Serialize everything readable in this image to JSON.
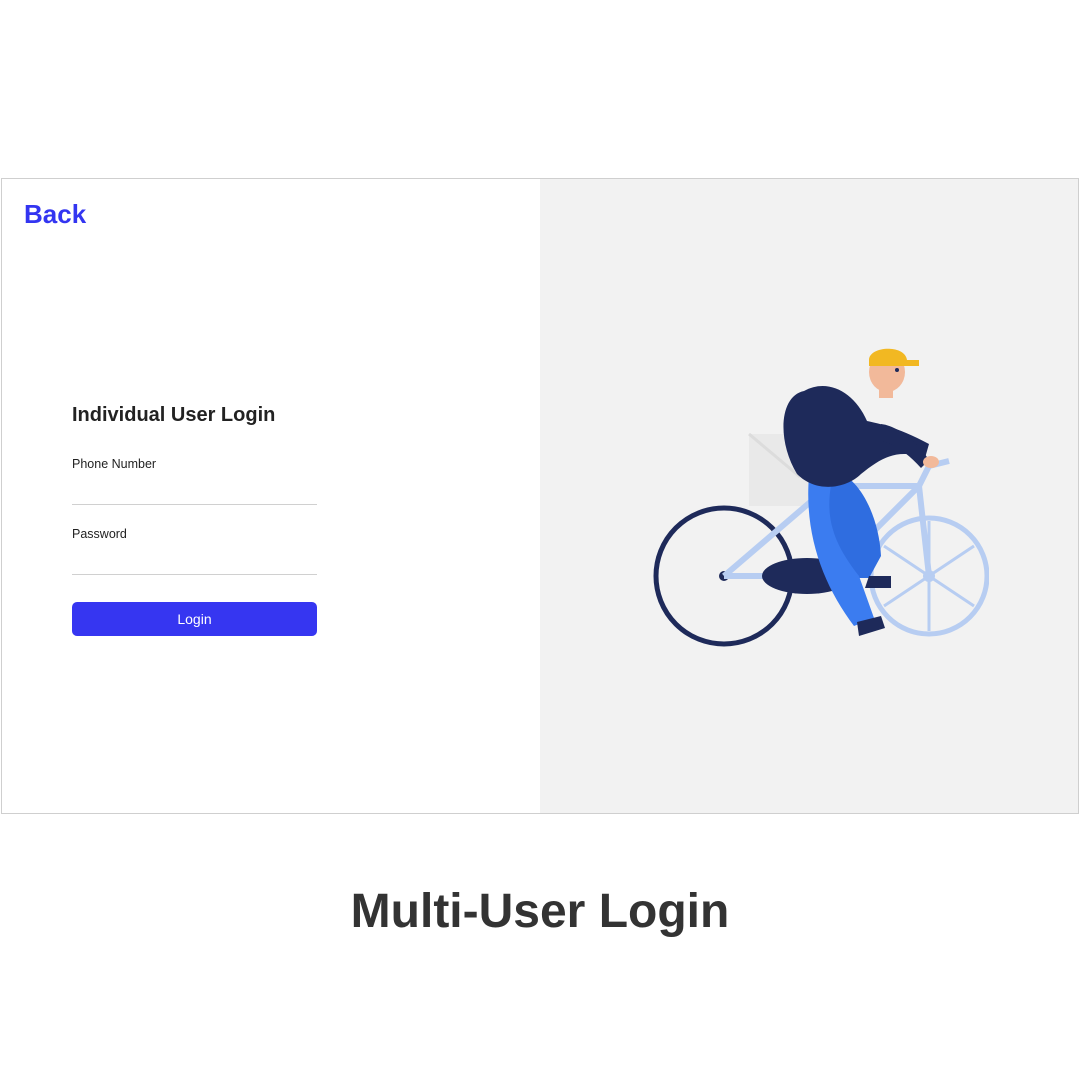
{
  "nav": {
    "back_label": "Back"
  },
  "form": {
    "title": "Individual User Login",
    "phone_label": "Phone Number",
    "password_label": "Password",
    "login_label": "Login"
  },
  "caption": "Multi-User Login",
  "colors": {
    "accent": "#3636f1",
    "panel_bg": "#f2f2f2"
  }
}
